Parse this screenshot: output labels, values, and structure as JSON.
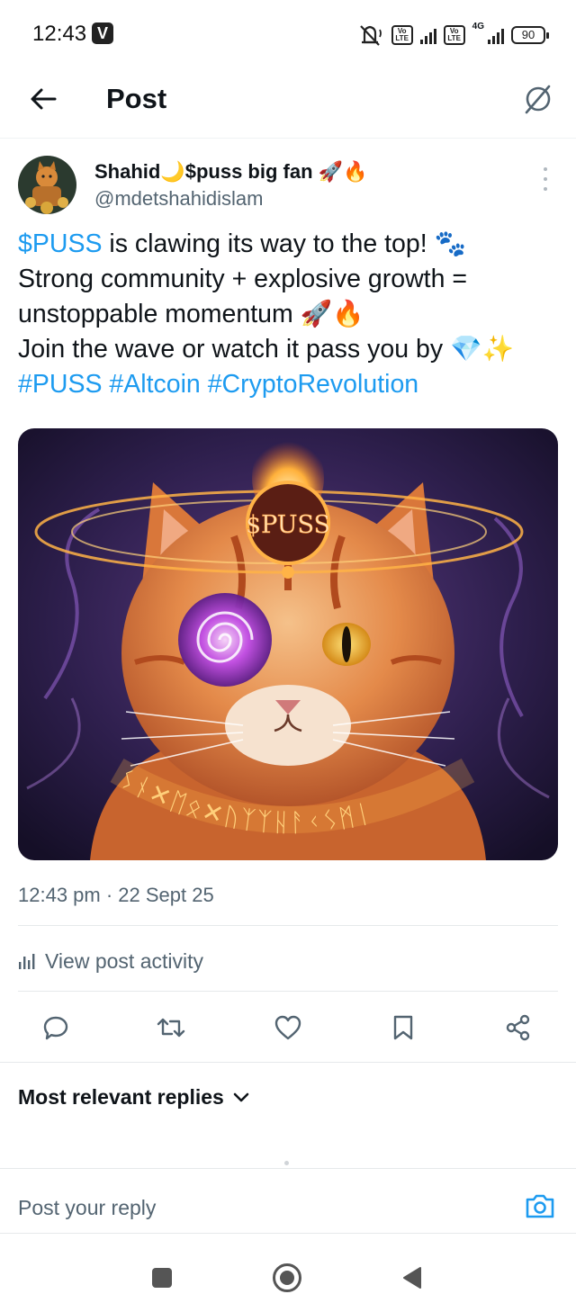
{
  "status_bar": {
    "time": "12:43",
    "v_badge": "V",
    "volte_1": "Vo LTE",
    "volte_2": "Vo LTE",
    "network": "4G",
    "battery": "90"
  },
  "header": {
    "title": "Post",
    "back_icon": "arrow-left-icon",
    "grok_icon": "grok-slash-circle-icon"
  },
  "post": {
    "author_name": "Shahid🌙$puss big fan 🚀🔥",
    "author_handle": "@mdetshahidislam",
    "text": {
      "cashtag": "$PUSS",
      "line1_rest": " is clawing its way to the top! 🐾",
      "line2": "Strong community + explosive growth =",
      "line3": "unstoppable momentum 🚀🔥",
      "line4": "Join the wave or watch it pass you by 💎✨",
      "hashtags": "#PUSS #Altcoin #CryptoRevolution"
    },
    "image": {
      "coin_text": "$PUSS",
      "collar_runes": "ᛊᚾ✕ᛖᛟ✕ᚢᛉᛉᚺᚨᚲᛊᛗᛁ"
    },
    "timestamp": "12:43 pm · 22 Sept 25",
    "activity_label": "View post activity"
  },
  "actions": {
    "reply_icon": "reply-icon",
    "repost_icon": "repost-icon",
    "like_icon": "heart-icon",
    "bookmark_icon": "bookmark-icon",
    "share_icon": "share-icon"
  },
  "replies": {
    "sort_label": "Most relevant replies"
  },
  "composer": {
    "placeholder": "Post your reply",
    "camera_icon": "camera-icon"
  },
  "colors": {
    "accent": "#1d9bf0",
    "text_primary": "#0f1419",
    "text_secondary": "#536471"
  }
}
